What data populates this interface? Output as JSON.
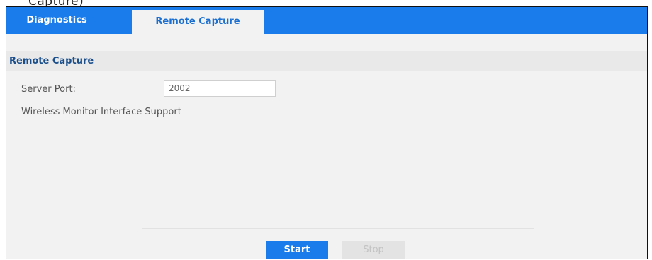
{
  "caption_fragment": "Capture)",
  "tabs": [
    {
      "label": "Diagnostics",
      "active": false
    },
    {
      "label": "Remote Capture",
      "active": true
    }
  ],
  "section": {
    "title": "Remote Capture"
  },
  "server_port": {
    "label": "Server Port:",
    "value": "2002"
  },
  "wireless_monitor": {
    "label": "Wireless Monitor Interface Support"
  },
  "buttons": {
    "start_label": "Start",
    "stop_label": "Stop"
  },
  "colors": {
    "accent": "#1a7bea",
    "section_title": "#1a4f8c",
    "panel_background": "#f2f2f2",
    "disabled_button": "#e3e3e3"
  }
}
